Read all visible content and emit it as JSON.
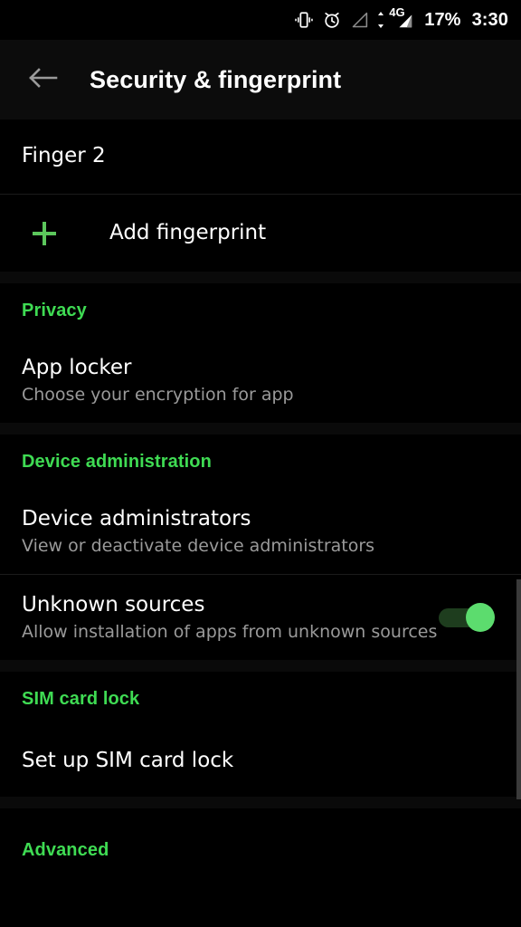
{
  "statusbar": {
    "icons": [
      "vibrate-icon",
      "alarm-icon",
      "signal-empty-icon",
      "data-transfer-icon",
      "signal-4g-icon"
    ],
    "network_label": "4G",
    "battery": "17%",
    "clock": "3:30"
  },
  "appbar": {
    "back_icon": "back-arrow-icon",
    "title": "Security & fingerprint"
  },
  "fingerprints": {
    "items": [
      {
        "label": "Finger 2"
      }
    ],
    "add": {
      "icon": "plus-icon",
      "label": "Add fingerprint"
    }
  },
  "sections": [
    {
      "header": "Privacy",
      "rows": [
        {
          "title": "App locker",
          "subtitle": "Choose your encryption for app",
          "control": "none"
        }
      ]
    },
    {
      "header": "Device administration",
      "rows": [
        {
          "title": "Device administrators",
          "subtitle": "View or deactivate device administrators",
          "control": "none"
        },
        {
          "title": "Unknown sources",
          "subtitle": "Allow installation of apps from unknown sources",
          "control": "switch",
          "switch_on": true
        }
      ]
    },
    {
      "header": "SIM card lock",
      "rows": [
        {
          "title": "Set up SIM card lock",
          "subtitle": "",
          "control": "none"
        }
      ]
    },
    {
      "header": "Advanced",
      "rows": []
    }
  ],
  "colors": {
    "background": "#000000",
    "appbar_background": "#0c0c0c",
    "section_gap": "#0a0a0a",
    "accent_green": "#3fdb53",
    "plus_green": "#5cc75c",
    "switch_track": "#1e3d1e",
    "switch_thumb": "#5cdc6e",
    "primary_text": "#ffffff",
    "secondary_text": "#9a9a9a",
    "back_arrow": "#9a9a9a",
    "divider": "#1b1b1b",
    "scrollbar": "#3a3a3a"
  }
}
